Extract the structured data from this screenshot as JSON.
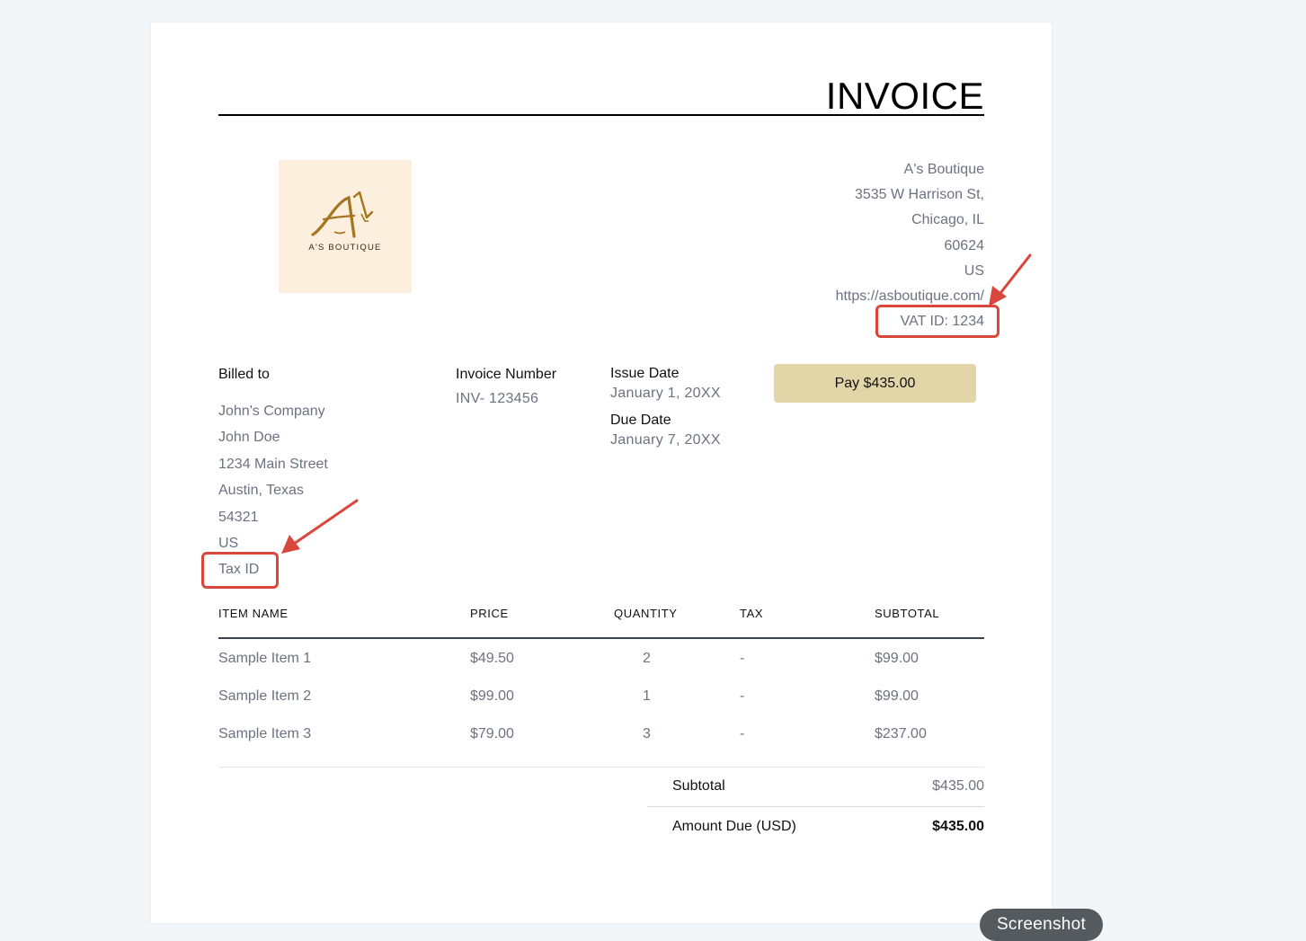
{
  "invoice": {
    "title": "INVOICE",
    "logo": {
      "brand_text": "A'S BOUTIQUE"
    },
    "seller": {
      "name": "A's Boutique",
      "street": "3535 W Harrison St,",
      "city": "Chicago, IL",
      "zip": "60624",
      "country": "US",
      "website": "https://asboutique.com/",
      "vat": "VAT ID: 1234"
    },
    "billed_to": {
      "label": "Billed to",
      "company": "John's Company",
      "name": "John Doe",
      "street": "1234 Main Street",
      "city": "Austin, Texas",
      "zip": "54321",
      "country": "US",
      "tax_id": "Tax ID"
    },
    "invoice_number": {
      "label": "Invoice Number",
      "value": "INV- 123456"
    },
    "issue_date": {
      "label": "Issue Date",
      "value": "January 1, 20XX"
    },
    "due_date": {
      "label": "Due Date",
      "value": "January 7, 20XX"
    },
    "pay_button": {
      "label": "Pay $435.00"
    },
    "table": {
      "headers": [
        "ITEM NAME",
        "PRICE",
        "QUANTITY",
        "TAX",
        "SUBTOTAL"
      ],
      "rows": [
        {
          "name": "Sample Item 1",
          "price": "$49.50",
          "qty": "2",
          "tax": "-",
          "subtotal": "$99.00"
        },
        {
          "name": "Sample Item 2",
          "price": "$99.00",
          "qty": "1",
          "tax": "-",
          "subtotal": "$99.00"
        },
        {
          "name": "Sample Item 3",
          "price": "$79.00",
          "qty": "3",
          "tax": "-",
          "subtotal": "$237.00"
        }
      ]
    },
    "totals": {
      "subtotal_label": "Subtotal",
      "subtotal_value": "$435.00",
      "amount_due_label": "Amount Due (USD)",
      "amount_due_value": "$435.00"
    }
  },
  "screenshot_button": {
    "label": "Screenshot"
  },
  "colors": {
    "page_bg": "#f2f6f8",
    "paper_bg": "#ffffff",
    "logo_bg": "#fdefde",
    "logo_gold": "#a5741e",
    "pay_button_bg": "#e2d6a8",
    "muted_text": "#6b7280",
    "annotation_red": "#d9463b"
  }
}
